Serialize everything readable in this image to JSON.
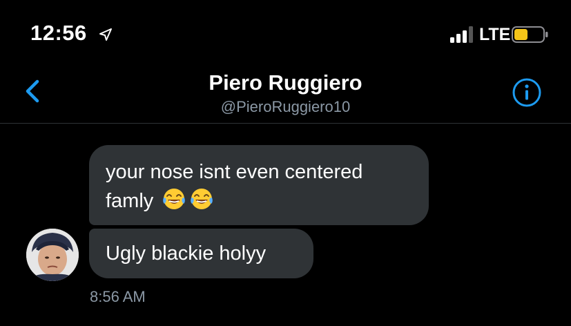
{
  "status_bar": {
    "time": "12:56",
    "network": "LTE",
    "battery_color": "#f5c518"
  },
  "header": {
    "name": "Piero Ruggiero",
    "handle": "@PieroRuggiero10",
    "accent_color": "#1d9bf0"
  },
  "messages": [
    {
      "line1": "your nose isnt even centered",
      "line2": "famly",
      "emoji": "face-with-tears-of-joy-icon"
    },
    {
      "text": "Ugly blackie holyy"
    }
  ],
  "timestamp": "8:56 AM"
}
